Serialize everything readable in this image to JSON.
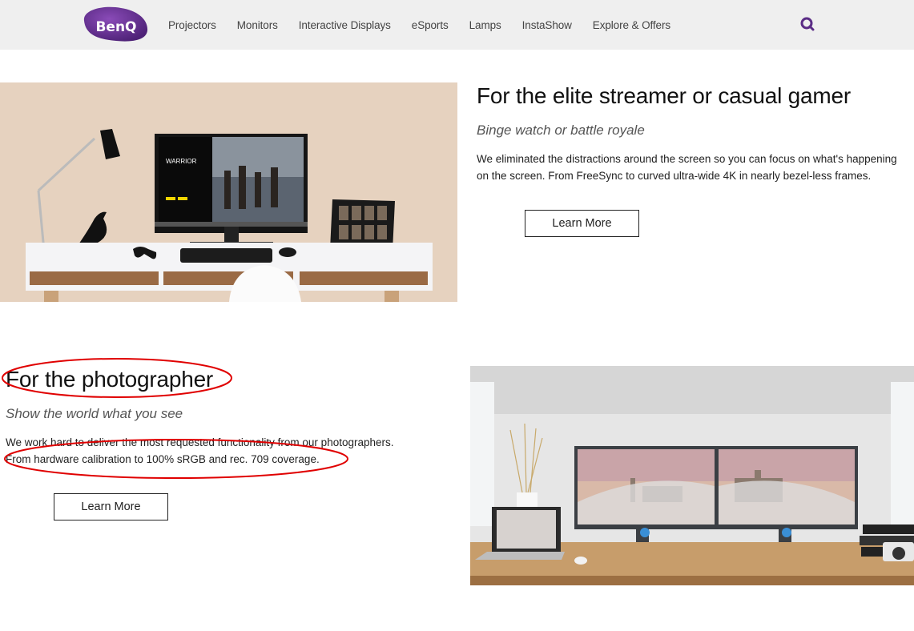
{
  "header": {
    "logo_text": "BenQ",
    "nav": [
      "Projectors",
      "Monitors",
      "Interactive Displays",
      "eSports",
      "Lamps",
      "InstaShow",
      "Explore & Offers"
    ],
    "search_icon": "search-icon"
  },
  "sections": [
    {
      "title": "For the elite streamer or casual gamer",
      "subtitle": "Binge watch or battle royale",
      "body_lines": [
        "We eliminated the distractions around the screen so you can focus on what's happening",
        "on the screen. From FreeSync to curved ultra-wide 4K in nearly bezel-less frames."
      ],
      "button": "Learn More",
      "image": {
        "description": "White desk with monitor showing WARRIOR movie, lamp, bird figurine, gamepad, keyboard, mouse, laptop",
        "screen_title": "WARRIOR"
      }
    },
    {
      "title": "For the photographer",
      "subtitle": "Show the world what you see",
      "body_lines": [
        "We work hard to deliver the most requested functionality from our photographers.",
        "From hardware calibration to 100% sRGB and rec. 709 coverage."
      ],
      "button": "Learn More",
      "image": {
        "description": "Dual monitors showing Shanghai skyline panorama on wooden desk with laptop, plant, books and camera"
      }
    }
  ],
  "colors": {
    "brand_purple": "#5b2d86",
    "header_bg": "#efefef",
    "annotation_red": "#e00000"
  }
}
